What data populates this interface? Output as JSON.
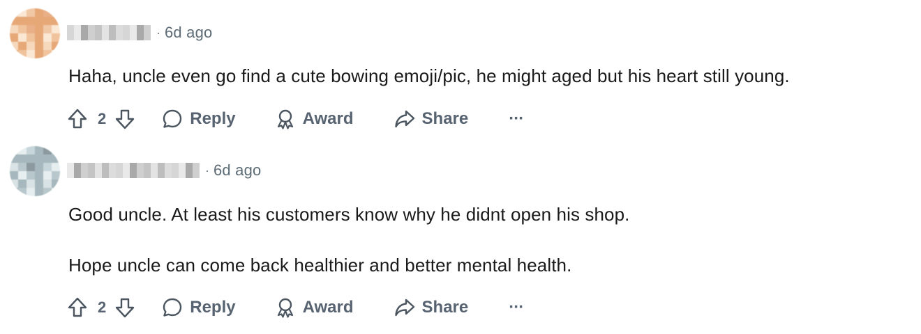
{
  "comments": [
    {
      "time": "6d ago",
      "separator": "·",
      "paragraphs": [
        "Haha, uncle even go find a cute bowing emoji/pic, he might aged but his heart still young."
      ],
      "votes": "2",
      "actions": {
        "reply": "Reply",
        "award": "Award",
        "share": "Share",
        "more": "···"
      },
      "avatar_colors": [
        "#f6d8bc",
        "#f0c39c",
        "#e9b088",
        "#e7a878",
        "#f1c8a6",
        "#fae7d4"
      ]
    },
    {
      "time": "6d ago",
      "separator": "·",
      "paragraphs": [
        "Good uncle. At least his customers know why he didnt open his shop.",
        "Hope uncle can come back healthier and better mental health."
      ],
      "votes": "2",
      "actions": {
        "reply": "Reply",
        "award": "Award",
        "share": "Share",
        "more": "···"
      },
      "avatar_colors": [
        "#d9e2e4",
        "#b8c7cc",
        "#8c9aa0",
        "#a6b8bd",
        "#c6d6da",
        "#e7eef0"
      ]
    }
  ],
  "colors": {
    "meta_text": "#5c6b75",
    "action_text": "#576370",
    "body_text": "#1a1a1b"
  }
}
